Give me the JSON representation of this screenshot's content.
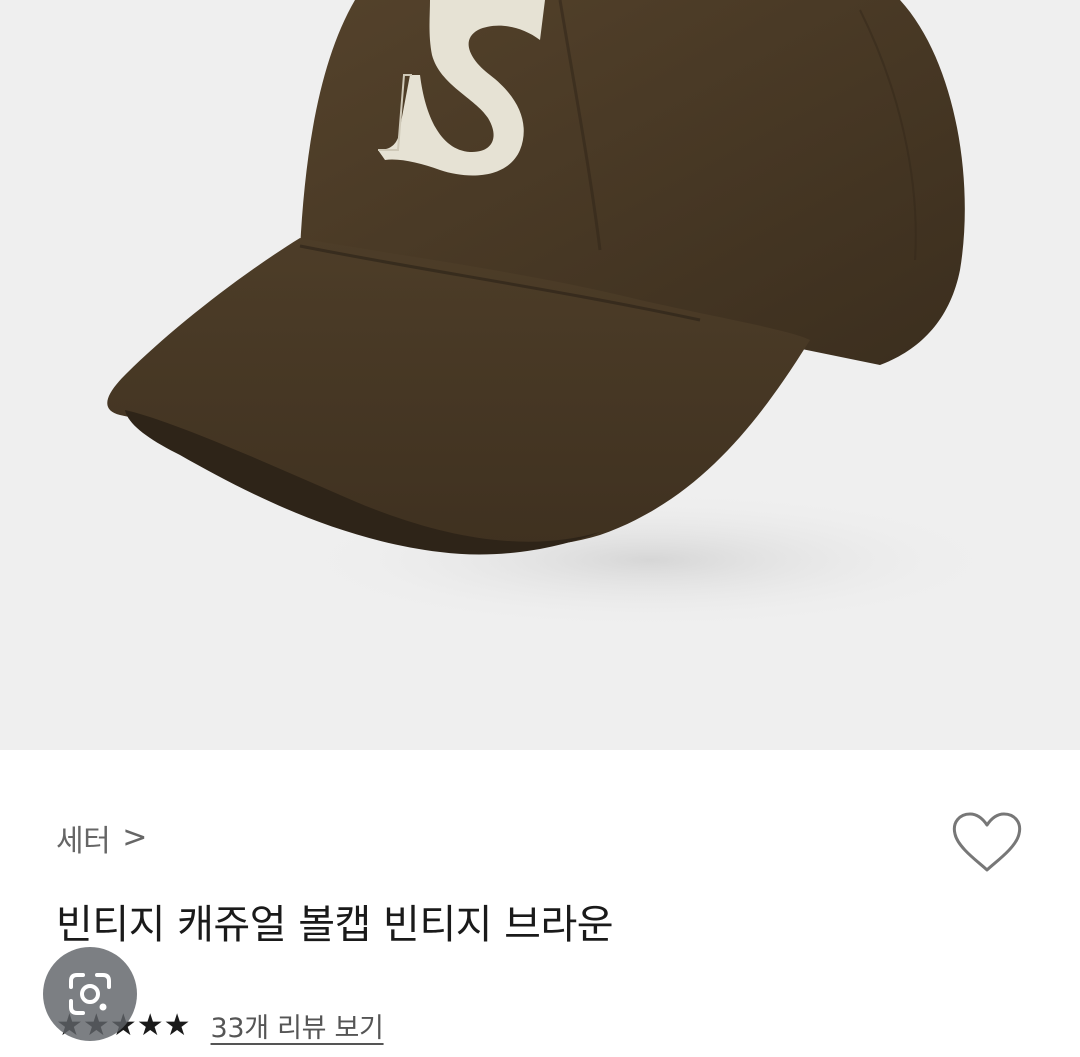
{
  "product": {
    "breadcrumb": "세터",
    "breadcrumb_chevron": ">",
    "title": "빈티지 캐쥬얼 볼캡 빈티지 브라운",
    "rating": 5,
    "rating_max": 5,
    "review_link": "33개 리뷰 보기",
    "image": "brown-baseball-cap-with-embroidered-S"
  },
  "icons": {
    "like": "heart-outline-icon",
    "lens": "google-lens-icon",
    "star": "★"
  },
  "colors": {
    "cap_brown": "#4a3a26",
    "embroidery": "#e6e2d4",
    "image_background": "#efefef",
    "text_primary": "#1a1a1a",
    "text_secondary": "#666666"
  }
}
